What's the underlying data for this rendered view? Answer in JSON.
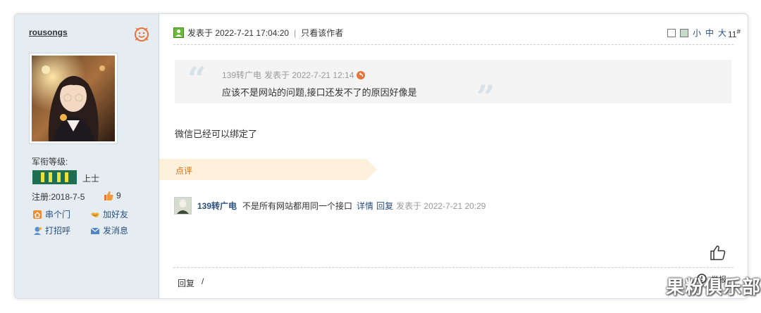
{
  "sidebar": {
    "username": "rousongs",
    "rank_label": "军衔等级:",
    "rank_name": "上士",
    "registered": "注册:2018-7-5",
    "likes": "9",
    "actions": {
      "visit": "串个门",
      "add_friend": "加好友",
      "greet": "打招呼",
      "message": "发消息"
    }
  },
  "post": {
    "posted_at": "发表于 2022-7-21 17:04:20",
    "separator": "|",
    "author_only": "只看该作者",
    "font_sizes": {
      "small": "小",
      "medium": "中",
      "large": "大"
    },
    "floor_number": "11",
    "floor_symbol": "#",
    "quote": {
      "author": "139转广电",
      "time": "发表于 2022-7-21 12:14",
      "text": "应该不是网站的问题,接口还发不了的原因好像是"
    },
    "body": "微信已经可以绑定了"
  },
  "comments": {
    "label": "点评",
    "items": [
      {
        "user": "139转广电",
        "text": "不是所有网站都用同一个接口",
        "detail": "详情",
        "reply": "回复",
        "time": "发表于 2022-7-21 20:29"
      }
    ]
  },
  "footer": {
    "reply": "回复",
    "slash": "/",
    "report": "举报"
  },
  "watermark": "果粉俱乐部",
  "colors": {
    "sidebar_bg": "#e5edf2",
    "link": "#2b4f7f",
    "rank_bar": "#1f6e54",
    "rank_stripes": "#e8e23b",
    "comment_accent": "#e36c11",
    "comment_tab_bg": "#fdf1dc"
  },
  "icons": {
    "online": "online-status-icon",
    "post": "post-author-icon",
    "quote_back": "jump-to-quote-icon",
    "like": "thumbs-up-icon",
    "report": "report-icon"
  }
}
